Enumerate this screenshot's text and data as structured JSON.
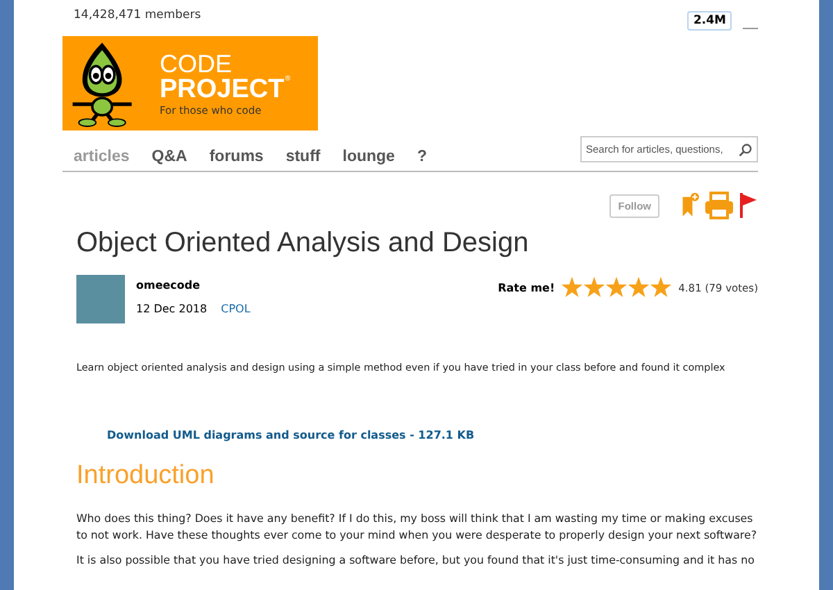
{
  "header": {
    "members": "14,428,471 members",
    "badge": "2.4M"
  },
  "logo": {
    "line1": "CODE",
    "line2": "PROJECT",
    "mark": "®",
    "tagline": "For those who code"
  },
  "nav": [
    {
      "label": "articles",
      "selected": true
    },
    {
      "label": "Q&A",
      "selected": false
    },
    {
      "label": "forums",
      "selected": false
    },
    {
      "label": "stuff",
      "selected": false
    },
    {
      "label": "lounge",
      "selected": false
    },
    {
      "label": "?",
      "selected": false
    }
  ],
  "search": {
    "placeholder": "Search for articles, questions,"
  },
  "actions": {
    "follow": "Follow"
  },
  "article": {
    "title": "Object Oriented Analysis and Design",
    "author": "omeecode",
    "date": "12 Dec 2018",
    "license": "CPOL",
    "rating": {
      "label": "Rate me!",
      "stars": 5,
      "score": "4.81 (79 votes)"
    },
    "summary": "Learn object oriented analysis and design using a simple method even if you have tried in your class before and found it complex",
    "download": "Download UML diagrams and source for classes - 127.1 KB",
    "heading": "Introduction",
    "paragraphs": [
      "Who does this thing? Does it have any benefit? If I do this, my boss will think that I am wasting my time or making excuses to not work. Have these thoughts ever come to your mind when you were desperate to properly design your next software?",
      "It is also possible that you have tried designing a software before, but you found that it's just time-consuming and it has no"
    ]
  }
}
